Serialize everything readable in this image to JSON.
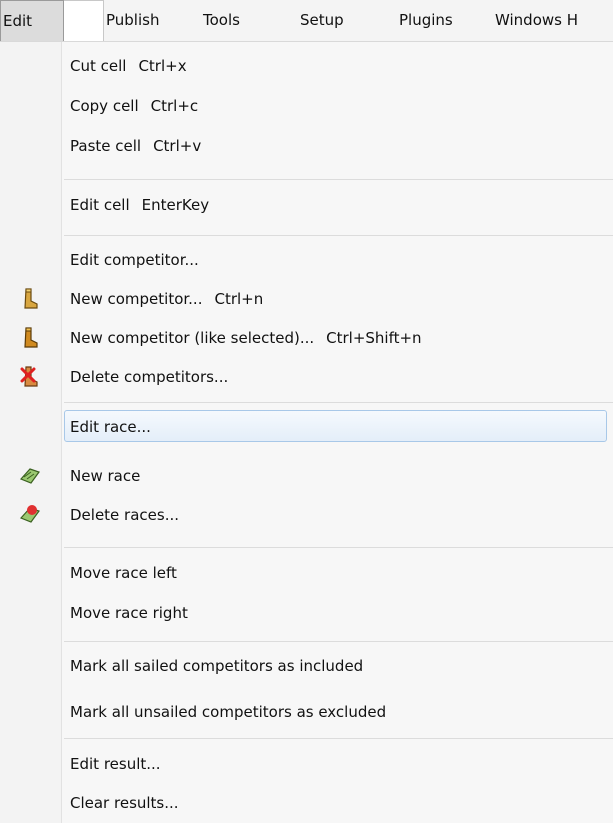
{
  "menubar": {
    "items": [
      "Edit",
      "Publish",
      "Tools",
      "Setup",
      "Plugins",
      "Windows H"
    ]
  },
  "menu": {
    "items": [
      {
        "label": "Cut cell",
        "shortcut": "Ctrl+x"
      },
      {
        "label": "Copy cell",
        "shortcut": "Ctrl+c"
      },
      {
        "label": "Paste cell",
        "shortcut": "Ctrl+v"
      },
      {
        "label": "Edit cell",
        "shortcut": "EnterKey"
      },
      {
        "label": "Edit competitor...",
        "shortcut": ""
      },
      {
        "label": "New competitor...",
        "shortcut": "Ctrl+n",
        "icon": "boot-icon"
      },
      {
        "label": "New competitor (like selected)...",
        "shortcut": "Ctrl+Shift+n",
        "icon": "boot-icon"
      },
      {
        "label": "Delete competitors...",
        "shortcut": "",
        "icon": "delete-boot-icon"
      },
      {
        "label": "Edit race...",
        "shortcut": "",
        "highlighted": true
      },
      {
        "label": "New race",
        "shortcut": "",
        "icon": "flag-icon"
      },
      {
        "label": "Delete races...",
        "shortcut": "",
        "icon": "delete-flag-icon"
      },
      {
        "label": "Move race left",
        "shortcut": ""
      },
      {
        "label": "Move race right",
        "shortcut": ""
      },
      {
        "label": "Mark all sailed competitors as included",
        "shortcut": ""
      },
      {
        "label": "Mark all unsailed competitors as excluded",
        "shortcut": ""
      },
      {
        "label": "Edit result...",
        "shortcut": ""
      },
      {
        "label": "Clear results...",
        "shortcut": ""
      }
    ]
  },
  "colors": {
    "highlight_border": "#a8c8e8",
    "highlight_fill": "#e4eef9",
    "menu_background": "#f7f7f7"
  }
}
